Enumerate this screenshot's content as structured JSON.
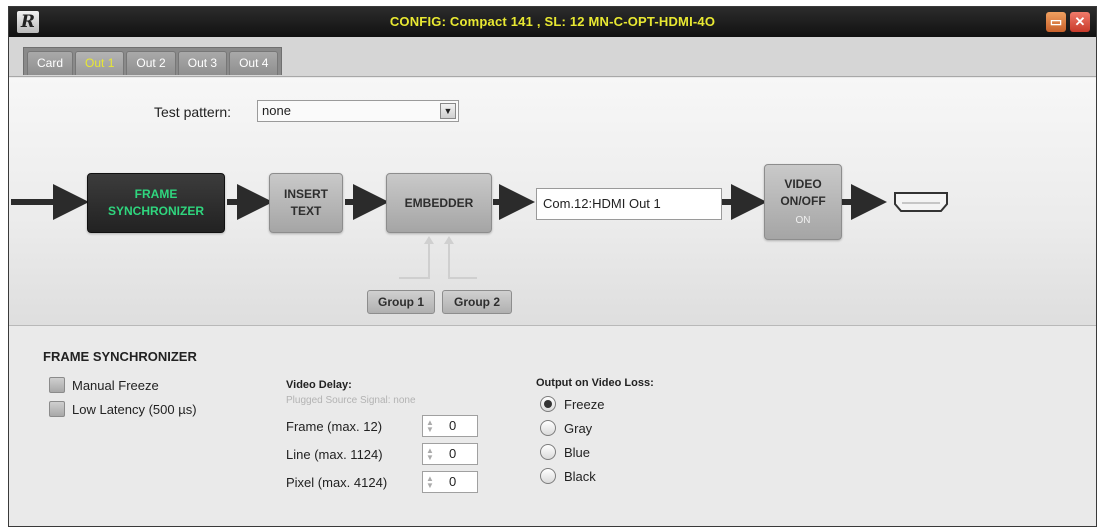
{
  "window": {
    "logo": "R",
    "title": "CONFIG: Compact 141 , SL: 12 MN-C-OPT-HDMI-4O",
    "minimize_label": "▭",
    "close_label": "✕"
  },
  "tabs": [
    {
      "label": "Card",
      "active": false
    },
    {
      "label": "Out 1",
      "active": true
    },
    {
      "label": "Out 2",
      "active": false
    },
    {
      "label": "Out 3",
      "active": false
    },
    {
      "label": "Out 4",
      "active": false
    }
  ],
  "test_pattern": {
    "label": "Test pattern:",
    "value": "none",
    "arrow": "▼"
  },
  "diagram": {
    "frame_sync": {
      "line1": "FRAME",
      "line2": "SYNCHRONIZER"
    },
    "insert_text": {
      "line1": "INSERT",
      "line2": "TEXT"
    },
    "embedder": {
      "label": "EMBEDDER"
    },
    "output_name": "Com.12:HDMI Out 1",
    "video_onoff": {
      "line1": "VIDEO",
      "line2": "ON/OFF",
      "state": "ON"
    },
    "group1": "Group 1",
    "group2": "Group 2",
    "icon_names": [
      "arrow-right-icon",
      "hdmi-port-icon"
    ]
  },
  "panel": {
    "title": "FRAME SYNCHRONIZER",
    "manual_freeze": {
      "label": "Manual Freeze",
      "checked": false
    },
    "low_latency": {
      "label": "Low Latency (500 µs)",
      "checked": false
    },
    "video_delay": {
      "title": "Video Delay:",
      "hint": "Plugged Source Signal: none",
      "frame": {
        "label": "Frame (max. 12)",
        "value": "0"
      },
      "line": {
        "label": "Line (max. 1124)",
        "value": "0"
      },
      "pixel": {
        "label": "Pixel (max. 4124)",
        "value": "0"
      }
    },
    "video_loss": {
      "title": "Output on Video Loss:",
      "options": [
        {
          "label": "Freeze",
          "selected": true
        },
        {
          "label": "Gray",
          "selected": false
        },
        {
          "label": "Blue",
          "selected": false
        },
        {
          "label": "Black",
          "selected": false
        }
      ]
    }
  },
  "colors": {
    "title_yellow": "#e8e832",
    "frame_sync_green": "#2fd67e",
    "arrow_dark": "#2b2b2b"
  }
}
